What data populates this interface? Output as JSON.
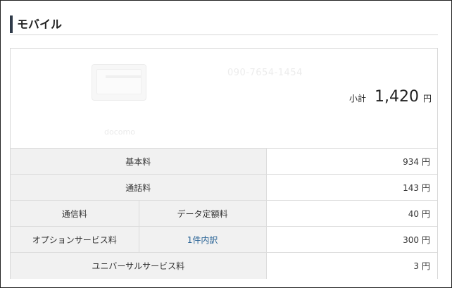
{
  "section": {
    "title": "モバイル"
  },
  "device": {
    "number": "090-7654-1454",
    "caption": "docomo"
  },
  "summary": {
    "subtotal_label": "小計",
    "subtotal_amount": "1,420",
    "currency": "円"
  },
  "fees": {
    "basic": {
      "label": "基本料",
      "amount": "934"
    },
    "call": {
      "label": "通話料",
      "amount": "143"
    },
    "comm": {
      "label": "通信料",
      "sub_label": "データ定額料",
      "amount": "40"
    },
    "option": {
      "label": "オプションサービス料",
      "link": "1件内訳",
      "amount": "300"
    },
    "universal": {
      "label": "ユニバーサルサービス料",
      "amount": "3"
    }
  },
  "colors": {
    "accent_bar": "#2f3a49",
    "label_bg": "#f1f1f1",
    "link": "#2a6496"
  }
}
